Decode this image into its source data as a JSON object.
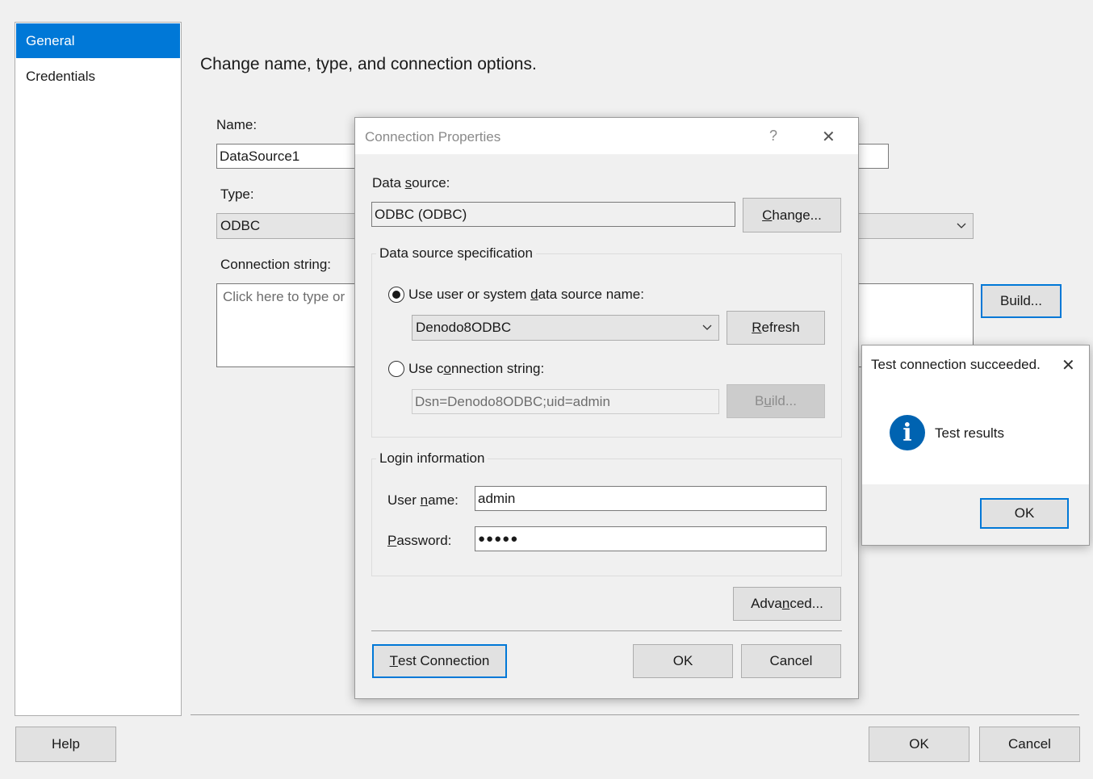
{
  "main": {
    "heading": "Change name, type, and connection options.",
    "sidebar": {
      "items": [
        {
          "label": "General",
          "selected": true
        },
        {
          "label": "Credentials",
          "selected": false
        }
      ]
    },
    "name_label": "Name:",
    "name_value": "DataSource1",
    "type_label": "Type:",
    "type_value": "ODBC",
    "conn_label": "Connection string:",
    "conn_placeholder": "Click here to type or",
    "build_button": "Build...",
    "help_button": "Help",
    "ok_button": "OK",
    "cancel_button": "Cancel"
  },
  "conn_dialog": {
    "title": "Connection Properties",
    "help_glyph": "?",
    "close_glyph": "✕",
    "data_source_label": {
      "pre": "Data ",
      "accel": "s",
      "post": "ource:"
    },
    "data_source_value": "ODBC (ODBC)",
    "change_button": {
      "pre": "",
      "accel": "C",
      "post": "hange..."
    },
    "spec_group_title": "Data source specification",
    "radio_dsn": {
      "pre": "Use user or system ",
      "accel": "d",
      "post": "ata source name:"
    },
    "dsn_value": "Denodo8ODBC",
    "refresh_button": {
      "pre": "",
      "accel": "R",
      "post": "efresh"
    },
    "radio_connstr": {
      "pre": "Use c",
      "accel": "o",
      "post": "nnection string:"
    },
    "connstr_value": "Dsn=Denodo8ODBC;uid=admin",
    "build_button": {
      "pre": "B",
      "accel": "u",
      "post": "ild..."
    },
    "login_group_title": "Login information",
    "username_label": {
      "pre": "User ",
      "accel": "n",
      "post": "ame:"
    },
    "username_value": "admin",
    "password_label": {
      "pre": "",
      "accel": "P",
      "post": "assword:"
    },
    "password_value": "●●●●●",
    "advanced_button": {
      "pre": "Adva",
      "accel": "n",
      "post": "ced..."
    },
    "test_button": {
      "pre": "",
      "accel": "T",
      "post": "est Connection"
    },
    "ok_button": "OK",
    "cancel_button": "Cancel"
  },
  "message_box": {
    "title": "Test connection succeeded.",
    "close_glyph": "✕",
    "icon_glyph": "i",
    "message": "Test results",
    "ok_button": "OK"
  },
  "colors": {
    "accent": "#0078d7",
    "info_icon": "#0063b1"
  }
}
